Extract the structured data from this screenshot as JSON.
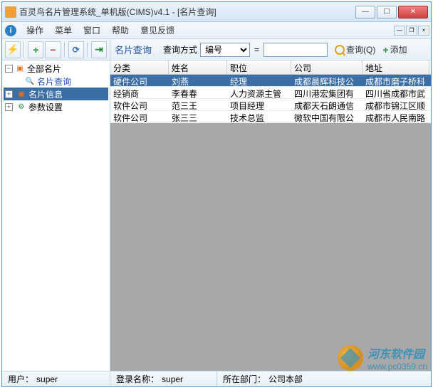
{
  "window": {
    "title": "百灵鸟名片管理系统_单机版(CIMS)v4.1 - [名片查询]"
  },
  "menu": {
    "items": [
      "操作",
      "菜单",
      "窗口",
      "帮助",
      "意见反馈"
    ]
  },
  "tree": {
    "root": "全部名片",
    "children": [
      {
        "label": "名片查询",
        "icon": "search"
      },
      {
        "label": "名片信息",
        "icon": "card",
        "selected": true,
        "expandable": true
      },
      {
        "label": "参数设置",
        "icon": "gear",
        "expandable": true
      }
    ]
  },
  "query": {
    "title": "名片查询",
    "mode_label": "查询方式",
    "mode_value": "编号",
    "eq": "=",
    "input_value": "",
    "search_btn": "查询(Q)",
    "add_btn": "添加"
  },
  "grid": {
    "columns": [
      "分类",
      "姓名",
      "职位",
      "公司",
      "地址"
    ],
    "rows": [
      {
        "cells": [
          "硬件公司",
          "刘燕",
          "经理",
          "成都晨辉科技公",
          "成都市磨子桥科"
        ],
        "selected": true
      },
      {
        "cells": [
          "经销商",
          "李春春",
          "人力资源主管",
          "四川港宏集团有",
          "四川省成都市武"
        ],
        "selected": false
      },
      {
        "cells": [
          "软件公司",
          "范三王",
          "项目经理",
          "成都天石朗通信",
          "成都市锦江区顺"
        ],
        "selected": false
      },
      {
        "cells": [
          "软件公司",
          "张三三",
          "技术总监",
          "微软中国有限公",
          "成都市人民南路"
        ],
        "selected": false
      }
    ]
  },
  "status": {
    "user_label": "用户：",
    "user": "super",
    "login_label": "登录名称：",
    "login": "super",
    "dept_label": "所在部门：",
    "dept": "公司本部"
  },
  "watermark": {
    "name": "河东软件园",
    "url": "www.pc0359.cn"
  }
}
